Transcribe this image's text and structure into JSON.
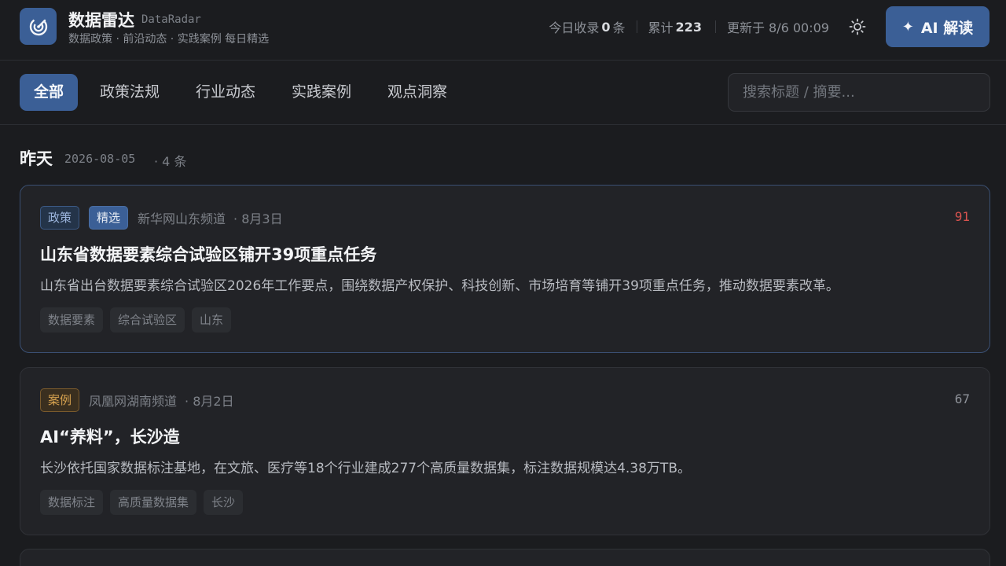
{
  "header": {
    "title": "数据雷达",
    "title_en": "DataRadar",
    "subtitle": "数据政策 · 前沿动态 · 实践案例 每日精选",
    "stats": {
      "today_label": "今日收录",
      "today_count": "0",
      "today_unit": "条",
      "total_label": "累计",
      "total_count": "223",
      "updated": "更新于 8/6 00:09"
    },
    "theme_icon": "sun-icon",
    "ai_button": "AI 解读"
  },
  "nav": {
    "tabs": [
      "全部",
      "政策法规",
      "行业动态",
      "实践案例",
      "观点洞察"
    ],
    "active_tab": "全部",
    "search_placeholder": "搜索标题 / 摘要..."
  },
  "section": {
    "title": "昨天",
    "date": "2026-08-05",
    "count": "· 4 条"
  },
  "articles": [
    {
      "badges": [
        "政策",
        "精选"
      ],
      "source": "新华网山东频道",
      "date": "· 8月3日",
      "score": "91",
      "score_color": "#d9534f",
      "title": "山东省数据要素综合试验区铺开39项重点任务",
      "summary": "山东省出台数据要素综合试验区2026年工作要点，围绕数据产权保护、科技创新、市场培育等铺开39项重点任务，推动数据要素改革。",
      "tags": [
        "数据要素",
        "综合试验区",
        "山东"
      ]
    },
    {
      "badges": [
        "案例"
      ],
      "source": "凤凰网湖南频道",
      "date": "· 8月2日",
      "score": "67",
      "score_color": "#8e9299",
      "title": "AI“养料”，长沙造",
      "summary": "长沙依托国家数据标注基地，在文旅、医疗等18个行业建成277个高质量数据集，标注数据规模达4.38万TB。",
      "tags": [
        "数据标注",
        "高质量数据集",
        "长沙"
      ]
    }
  ]
}
